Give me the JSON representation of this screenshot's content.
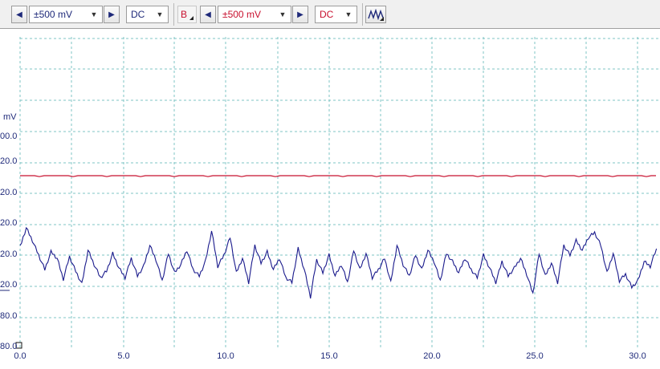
{
  "toolbar": {
    "channel_a": {
      "range": "±500 mV",
      "coupling": "DC"
    },
    "channel_b": {
      "label": "B",
      "range": "±500 mV",
      "coupling": "DC"
    }
  },
  "colors": {
    "channel_a": "#1a1a8c",
    "channel_b": "#c8102e",
    "grid": "#7fc4c4",
    "axis_text": "#1f2a7a"
  },
  "icons": {
    "left_arrow": "triangle-left-icon",
    "right_arrow": "triangle-right-icon",
    "dropdown": "chevron-down-icon",
    "trigger": "waveform-icon"
  },
  "chart_data": {
    "type": "line",
    "y_unit": "mV",
    "y_tick_labels": [
      "00.0",
      "20.0",
      "20.0",
      "20.0",
      "20.0",
      "20.0",
      "80.0",
      "80.0"
    ],
    "x_ticks": [
      "0.0",
      "5.0",
      "10.0",
      "15.0",
      "20.0",
      "25.0",
      "30.0"
    ],
    "xlim": [
      0,
      31
    ],
    "grid": true,
    "series": [
      {
        "channel": "A",
        "color": "#1a1a8c",
        "x": [
          0.0,
          0.3,
          0.6,
          0.9,
          1.2,
          1.5,
          1.8,
          2.1,
          2.4,
          2.7,
          3.0,
          3.3,
          3.6,
          3.9,
          4.2,
          4.5,
          4.8,
          5.1,
          5.4,
          5.7,
          6.0,
          6.3,
          6.6,
          6.9,
          7.2,
          7.5,
          7.8,
          8.1,
          8.4,
          8.7,
          9.0,
          9.3,
          9.6,
          9.9,
          10.2,
          10.5,
          10.8,
          11.1,
          11.4,
          11.7,
          12.0,
          12.3,
          12.6,
          12.9,
          13.2,
          13.5,
          13.8,
          14.1,
          14.4,
          14.7,
          15.0,
          15.3,
          15.6,
          15.9,
          16.2,
          16.5,
          16.8,
          17.1,
          17.4,
          17.7,
          18.0,
          18.3,
          18.6,
          18.9,
          19.2,
          19.5,
          19.8,
          20.1,
          20.4,
          20.7,
          21.0,
          21.3,
          21.6,
          21.9,
          22.2,
          22.5,
          22.8,
          23.1,
          23.4,
          23.7,
          24.0,
          24.3,
          24.6,
          24.9,
          25.2,
          25.5,
          25.8,
          26.1,
          26.4,
          26.7,
          27.0,
          27.3,
          27.6,
          27.9,
          28.2,
          28.5,
          28.8,
          29.1,
          29.4,
          29.7,
          30.0,
          30.3,
          30.6,
          30.9
        ],
        "y": [
          308,
          284,
          300,
          318,
          336,
          314,
          322,
          348,
          320,
          338,
          354,
          312,
          330,
          346,
          338,
          316,
          334,
          346,
          322,
          344,
          332,
          306,
          324,
          350,
          316,
          340,
          330,
          312,
          336,
          344,
          326,
          288,
          332,
          318,
          296,
          340,
          322,
          352,
          306,
          328,
          314,
          336,
          322,
          346,
          352,
          310,
          336,
          370,
          324,
          340,
          318,
          344,
          330,
          352,
          312,
          336,
          316,
          346,
          336,
          322,
          352,
          306,
          330,
          344,
          318,
          336,
          312,
          326,
          350,
          316,
          326,
          340,
          322,
          336,
          346,
          318,
          334,
          352,
          326,
          344,
          334,
          322,
          342,
          366,
          316,
          344,
          328,
          352,
          306,
          318,
          300,
          312,
          296,
          290,
          306,
          340,
          316,
          350,
          342,
          358,
          350,
          326,
          332,
          310
        ],
        "y_note_values_are_screen_relative": true
      },
      {
        "channel": "B",
        "color": "#c8102e",
        "constant_level_label_index": 2
      }
    ]
  }
}
